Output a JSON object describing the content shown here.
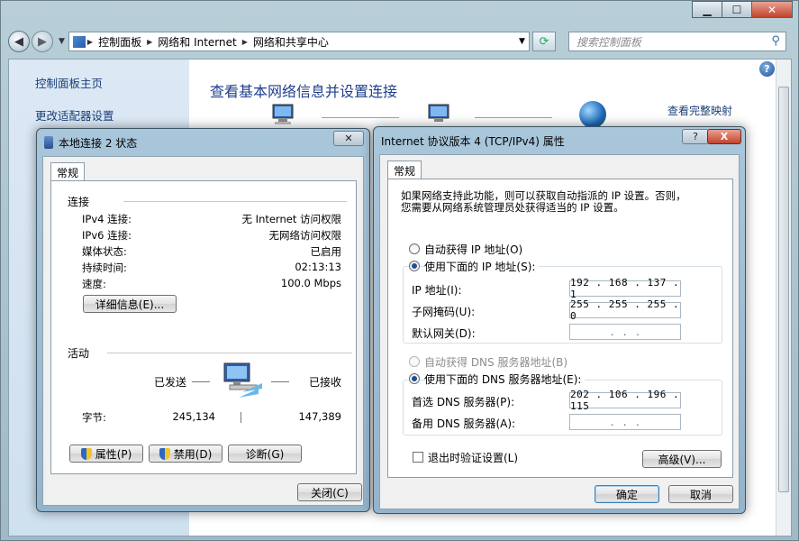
{
  "explorer": {
    "breadcrumb": [
      "控制面板",
      "网络和 Internet",
      "网络和共享中心"
    ],
    "search_placeholder": "搜索控制面板",
    "left_links": [
      "控制面板主页",
      "更改适配器设置"
    ],
    "main_title": "查看基本网络信息并设置连接",
    "full_map_link": "查看完整映射"
  },
  "status_dialog": {
    "title": "本地连接 2 状态",
    "tab": "常规",
    "connection_group": "连接",
    "rows": [
      {
        "k": "IPv4 连接:",
        "v": "无 Internet 访问权限"
      },
      {
        "k": "IPv6 连接:",
        "v": "无网络访问权限"
      },
      {
        "k": "媒体状态:",
        "v": "已启用"
      },
      {
        "k": "持续时间:",
        "v": "02:13:13"
      },
      {
        "k": "速度:",
        "v": "100.0 Mbps"
      }
    ],
    "details_button": "详细信息(E)...",
    "activity_group": "活动",
    "sent_label": "已发送",
    "received_label": "已接收",
    "bytes_label": "字节:",
    "bytes_sent": "245,134",
    "bytes_received": "147,389",
    "properties_button": "属性(P)",
    "disable_button": "禁用(D)",
    "diagnose_button": "诊断(G)",
    "close_button": "关闭(C)"
  },
  "ipv4_dialog": {
    "title": "Internet 协议版本 4 (TCP/IPv4) 属性",
    "tab": "常规",
    "description_line1": "如果网络支持此功能，则可以获取自动指派的 IP 设置。否则，",
    "description_line2": "您需要从网络系统管理员处获得适当的 IP 设置。",
    "auto_ip": "自动获得 IP 地址(O)",
    "manual_ip": "使用下面的 IP 地址(S):",
    "ip_label": "IP 地址(I):",
    "ip_value": "192 . 168 . 137 .  1",
    "mask_label": "子网掩码(U):",
    "mask_value": "255 . 255 . 255 .  0",
    "gateway_label": "默认网关(D):",
    "gateway_value": ".     .     .",
    "auto_dns": "自动获得 DNS 服务器地址(B)",
    "manual_dns": "使用下面的 DNS 服务器地址(E):",
    "dns1_label": "首选 DNS 服务器(P):",
    "dns1_value": "202 . 106 . 196 . 115",
    "dns2_label": "备用 DNS 服务器(A):",
    "dns2_value": ".     .     .",
    "validate_label": "退出时验证设置(L)",
    "advanced_button": "高级(V)...",
    "ok_button": "确定",
    "cancel_button": "取消",
    "help_glyph": "?",
    "close_glyph": "X"
  }
}
